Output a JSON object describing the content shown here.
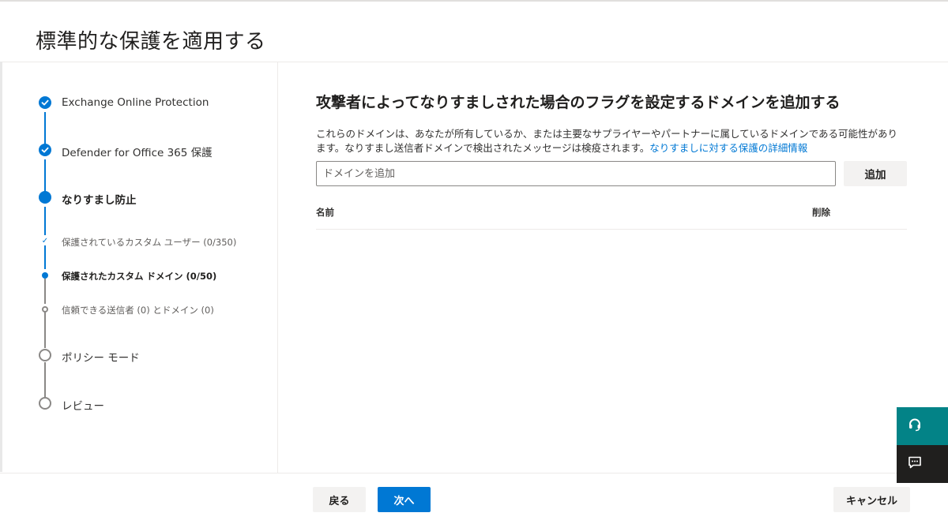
{
  "page": {
    "title": "標準的な保護を適用する"
  },
  "steps": [
    {
      "label": "Exchange Online Protection",
      "state": "done"
    },
    {
      "label": "Defender for Office 365 保護",
      "state": "done"
    },
    {
      "label": "なりすまし防止",
      "state": "current"
    },
    {
      "label": "保護されているカスタム ユーザー (0/350)",
      "state": "sub-done"
    },
    {
      "label": "保護されたカスタム ドメイン (0/50)",
      "state": "sub-current"
    },
    {
      "label": "信頼できる送信者 (0) とドメイン (0)",
      "state": "sub-empty"
    },
    {
      "label": "ポリシー モード",
      "state": "empty"
    },
    {
      "label": "レビュー",
      "state": "empty"
    }
  ],
  "content": {
    "title": "攻撃者によってなりすましされた場合のフラグを設定するドメインを追加する",
    "description": "これらのドメインは、あなたが所有しているか、または主要なサプライヤーやパートナーに属しているドメインである可能性があります。なりすまし送信者ドメインで検出されたメッセージは検疫されます。",
    "learn_more_link": "なりすましに対する保護の詳細情報",
    "input_placeholder": "ドメインを追加",
    "input_value": "",
    "add_button": "追加",
    "table": {
      "columns": [
        "名前",
        "削除"
      ]
    }
  },
  "footer": {
    "back": "戻る",
    "next": "次へ",
    "cancel": "キャンセル"
  },
  "icons": {
    "help": "headset-icon",
    "feedback": "feedback-icon"
  },
  "colors": {
    "accent": "#0078d4",
    "help_bg": "#038387",
    "feedback_bg": "#201f1e"
  }
}
